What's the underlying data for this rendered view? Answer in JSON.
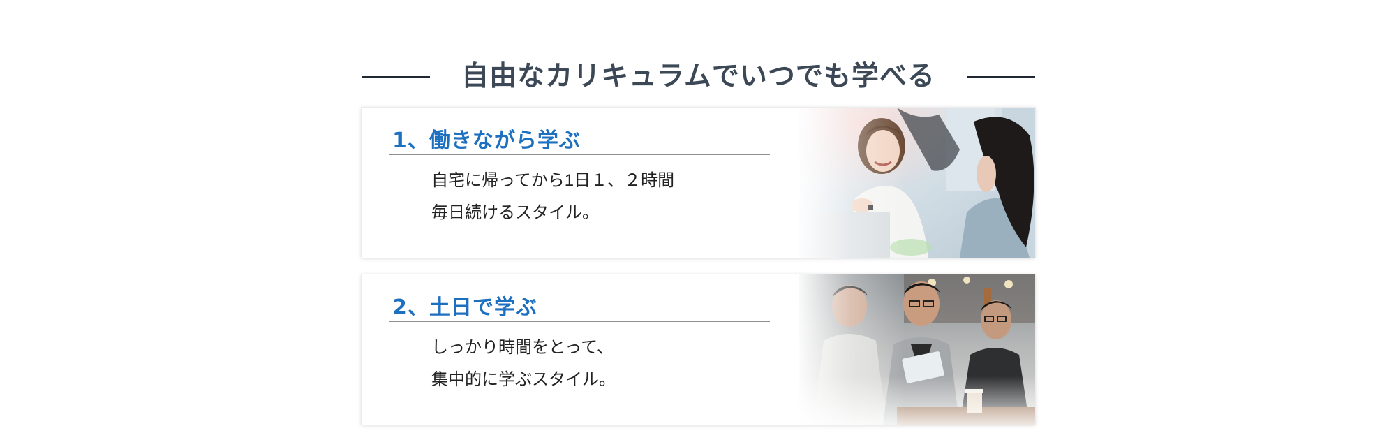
{
  "heading": {
    "title": "自由なカリキュラムでいつでも学べる"
  },
  "cards": [
    {
      "title": "1、働きながら学ぶ",
      "lines": [
        "自宅に帰ってから1日１、２時間",
        "毎日続けるスタイル。"
      ],
      "photo": "office-women-talking-photo"
    },
    {
      "title": "2、土日で学ぶ",
      "lines": [
        "しっかり時間をとって、",
        "集中的に学ぶスタイル。"
      ],
      "photo": "men-cafe-tablet-photo"
    }
  ],
  "colors": {
    "heading": "#3c4856",
    "card_title": "#1d6fc0",
    "divider": "#222831"
  }
}
